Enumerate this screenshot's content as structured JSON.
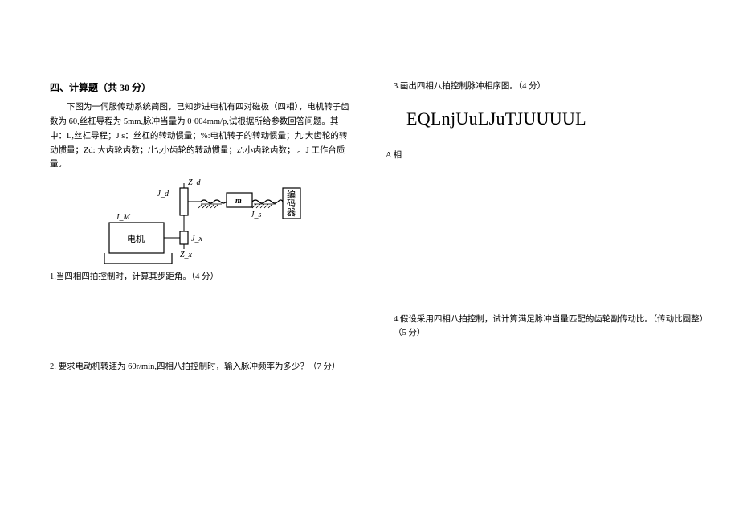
{
  "left": {
    "section_title": "四、计算题（共 30 分）",
    "intro": "下图为一伺服传动系统简图，已知步进电机有四对磁极（四相），电机转子齿数为 60,丝杠导程为 5mm,脉冲当量为 0·004mm/p,试根据所给参数回答问题。其中：L,丝杠导程；J s：丝杠的转动惯量；%:电机转子的转动惯量；九:大齿轮的转动惯量；Zd: 大齿轮齿数；/匕;小齿轮的转动惯量；z':小齿轮齿数； 。J 工作台质量。",
    "diagram": {
      "motor": "电机",
      "jm": "J_M",
      "jx": "J_x",
      "zx": "Z_x",
      "jd": "J_d",
      "zd": "Z_d",
      "m": "m",
      "js": "J_s",
      "encoder_l1": "编",
      "encoder_l2": "码",
      "encoder_l3": "器"
    },
    "q1": "1.当四相四拍控制时，计算其步距角。（4 分）",
    "q2": "2. 要求电动机转速为 60r/min,四相八拍控制时，输入脉冲频率为多少？（7 分）"
  },
  "right": {
    "q3": "3.画出四相八拍控制脉冲相序图。（4 分）",
    "big_text": "EQLnjUuLJuTJUUUUL",
    "phase_a": "A 相",
    "q4": "4.假设采用四相八拍控制，试计算满足脉冲当量匹配的齿轮副传动比。（传动比圆整）（5 分）"
  }
}
